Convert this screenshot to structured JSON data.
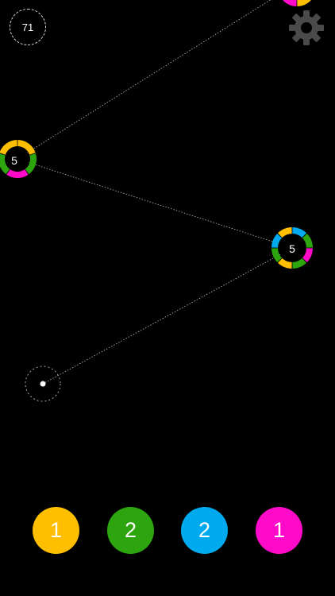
{
  "score": "71",
  "settings_icon": "gear-icon",
  "colors": {
    "yellow": "#ffbf00",
    "green": "#2da50e",
    "blue": "#00aaee",
    "magenta": "#ff0ac8",
    "link": "#bdbdbd",
    "gear": "#4a4a4a"
  },
  "nodes": [
    {
      "id": "node-top-right",
      "label": "",
      "segments": [
        "magenta",
        "yellow",
        "magenta",
        "green"
      ]
    },
    {
      "id": "node-left",
      "label": "5",
      "segments": [
        "yellow",
        "green",
        "magenta",
        "green",
        "yellow"
      ]
    },
    {
      "id": "node-right",
      "label": "5",
      "segments": [
        "blue",
        "green",
        "magenta",
        "green",
        "yellow",
        "green",
        "blue",
        "yellow"
      ]
    }
  ],
  "palette": [
    {
      "color": "yellow",
      "count": "1"
    },
    {
      "color": "green",
      "count": "2"
    },
    {
      "color": "blue",
      "count": "2"
    },
    {
      "color": "magenta",
      "count": "1"
    }
  ]
}
